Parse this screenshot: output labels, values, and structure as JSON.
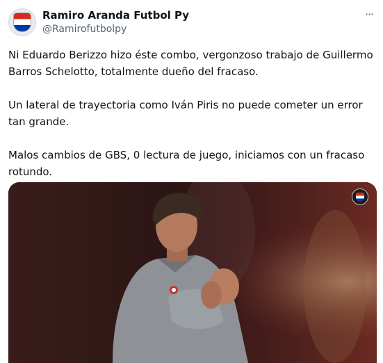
{
  "author": {
    "display_name": "Ramiro Aranda Futbol Py",
    "handle": "@Ramirofutbolpy",
    "avatar_icon": "paraguay-flag-shield-icon"
  },
  "more_icon": "more-options-icon",
  "tweet": {
    "text": "Ni Eduardo Berizzo hizo éste combo, vergonzoso trabajo de Guillermo Barros Schelotto, totalmente dueño del fracaso.\n\nUn lateral de trayectoria como Iván Piris no puede cometer un error tan grande.\n\nMalos cambios de GBS, 0 lectura de juego, iniciamos con un fracaso rotundo."
  },
  "media": {
    "badge_icon": "paraguay-shield-logo-icon"
  },
  "colors": {
    "text_primary": "#0f1419",
    "text_secondary": "#536471",
    "background": "#ffffff"
  }
}
